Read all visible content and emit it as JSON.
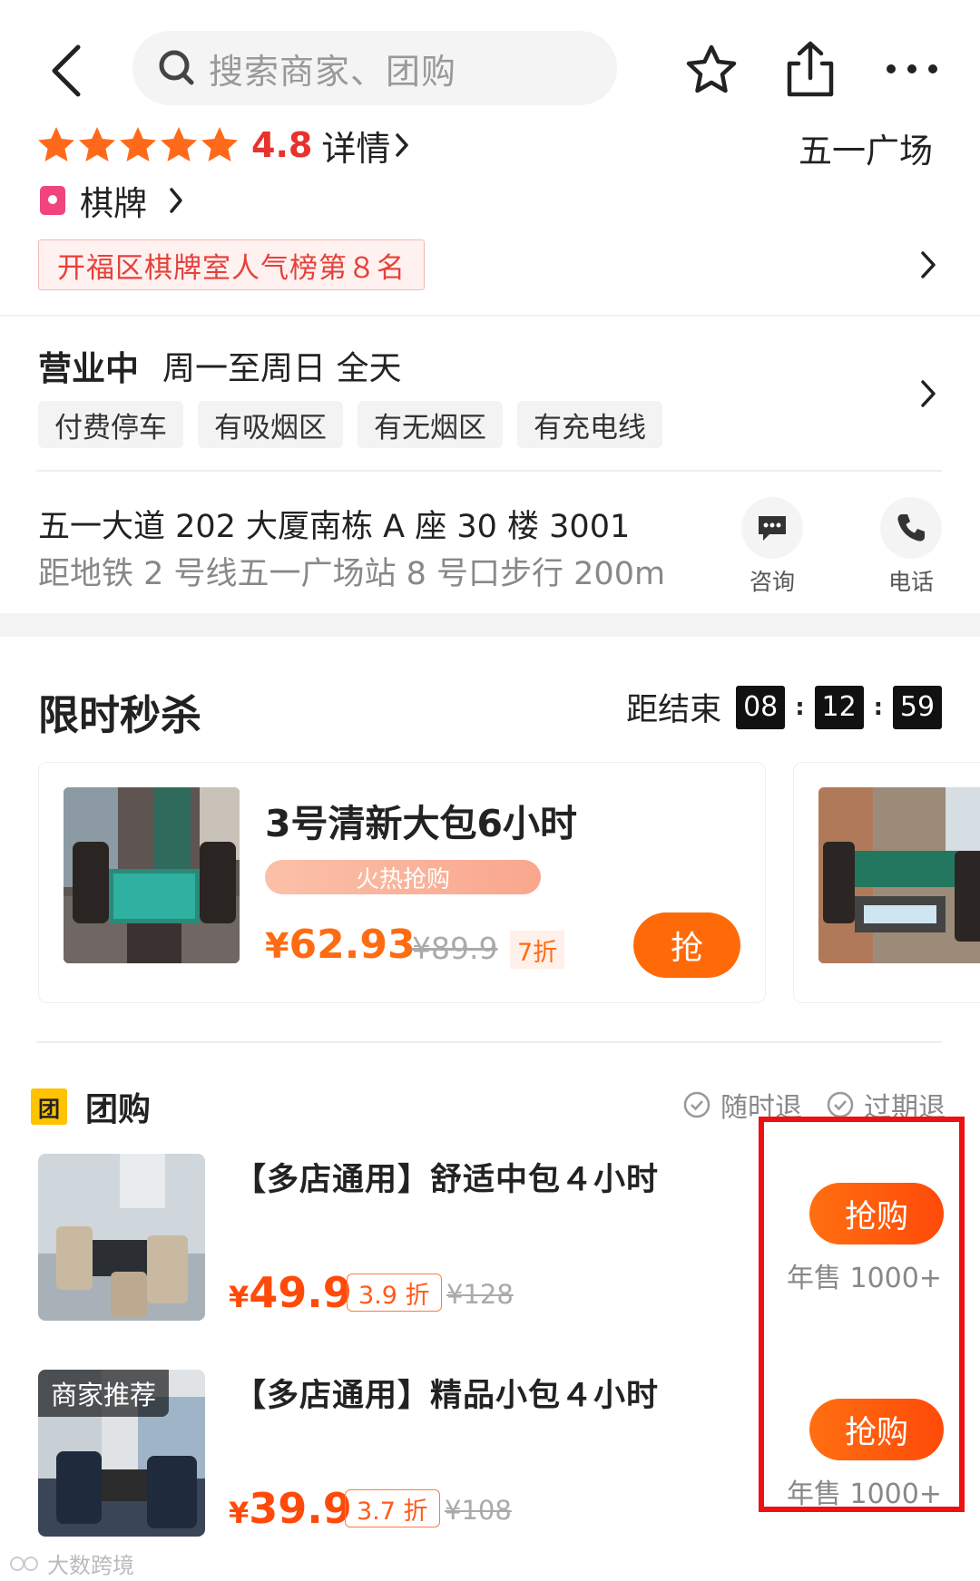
{
  "topbar": {
    "search_placeholder": "搜索商家、团购",
    "back_icon": "back-arrow-icon",
    "favorite_icon": "star-outline-icon",
    "share_icon": "share-icon",
    "more_icon": "more-dots-icon"
  },
  "shop": {
    "rating": "4.8",
    "rating_stars": 5,
    "details_label": "详情",
    "location": "五一广场",
    "category": "棋牌",
    "rank_text": "开福区棋牌室人气榜第８名",
    "status": "营业中",
    "hours": "周一至周日 全天",
    "tags": [
      "付费停车",
      "有吸烟区",
      "有无烟区",
      "有充电线"
    ],
    "address": "五一大道 202 大厦南栋 A 座 30 楼 3001",
    "distance": "距地铁 2 号线五一广场站 8 号口步行 200m",
    "consult_label": "咨询",
    "phone_label": "电话"
  },
  "flash_sale": {
    "title": "限时秒杀",
    "countdown_label": "距结束",
    "countdown": [
      "08",
      "12",
      "59"
    ],
    "item": {
      "name": "3号清新大包6小时",
      "hot_label": "火热抢购",
      "currency": "¥",
      "price": "62.93",
      "original_price": "¥89.9",
      "discount": "7折",
      "grab_label": "抢"
    }
  },
  "group_buy": {
    "icon_text": "团",
    "title": "团购",
    "refund_anytime": "随时退",
    "refund_expired": "过期退",
    "items": [
      {
        "name": "【多店通用】舒适中包４小时",
        "currency": "¥",
        "price": "49.9",
        "discount": "3.9 折",
        "original_price": "¥128",
        "buy_label": "抢购",
        "sold": "年售 1000+"
      },
      {
        "badge": "商家推荐",
        "name": "【多店通用】精品小包４小时",
        "currency": "¥",
        "price": "39.9",
        "discount": "3.7 折",
        "original_price": "¥108",
        "buy_label": "抢购",
        "sold": "年售 1000+"
      }
    ]
  },
  "watermark": "大数跨境",
  "colors": {
    "accent_orange": "#ff6a08",
    "rating_red": "#e8322d",
    "star_orange": "#ff6a1a",
    "highlight_red": "#ee1111"
  }
}
